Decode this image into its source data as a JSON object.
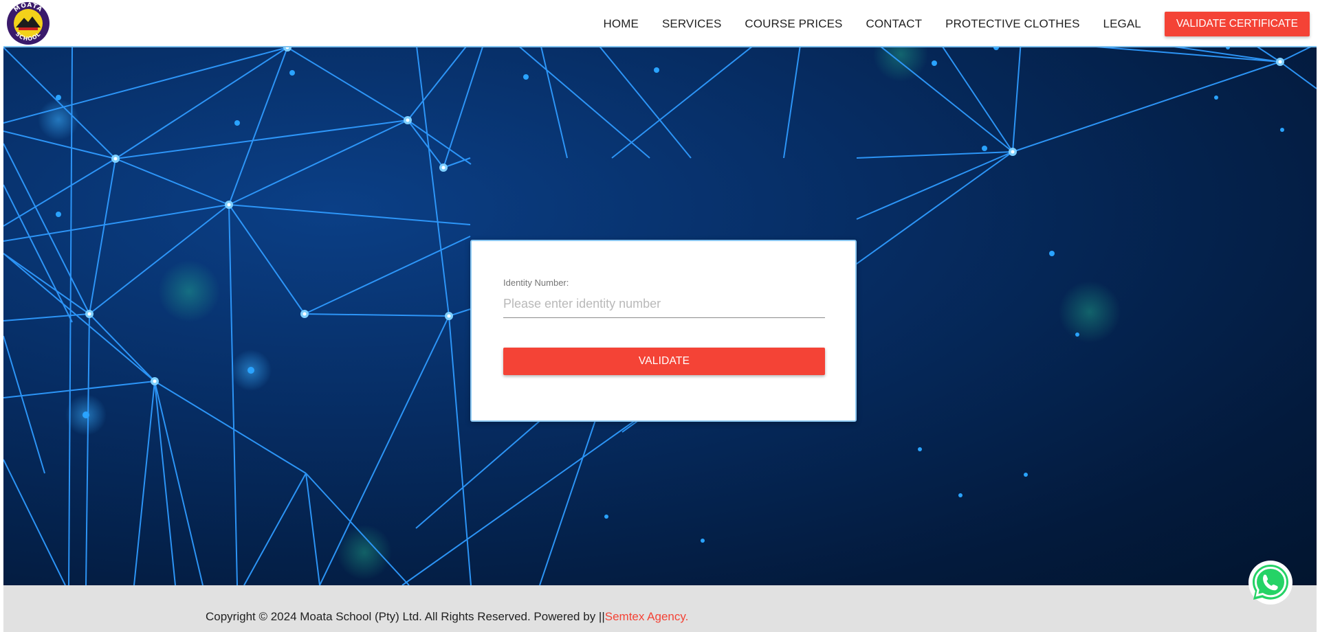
{
  "logo": {
    "top_text": "MOATA",
    "bottom_text": "SCHOOL"
  },
  "nav": {
    "items": [
      {
        "label": "HOME"
      },
      {
        "label": "SERVICES"
      },
      {
        "label": "COURSE PRICES"
      },
      {
        "label": "CONTACT"
      },
      {
        "label": "PROTECTIVE CLOTHES"
      },
      {
        "label": "LEGAL"
      }
    ],
    "cta_label": "VALIDATE CERTIFICATE"
  },
  "form": {
    "label": "Identity Number:",
    "placeholder": "Please enter identity number",
    "value": "",
    "button_label": "VALIDATE"
  },
  "footer": {
    "text": "Copyright © 2024 Moata School (Pty) Ltd. All Rights Reserved. Powered by ||",
    "link": "Semtex Agency."
  },
  "colors": {
    "accent": "#f44336",
    "hero_bg": "#062c62",
    "network_line": "#2f9bff",
    "footer_bg": "#e1e1e1",
    "whatsapp": "#25d366"
  },
  "icons": {
    "whatsapp": "whatsapp-icon",
    "logo": "school-logo-badge"
  }
}
